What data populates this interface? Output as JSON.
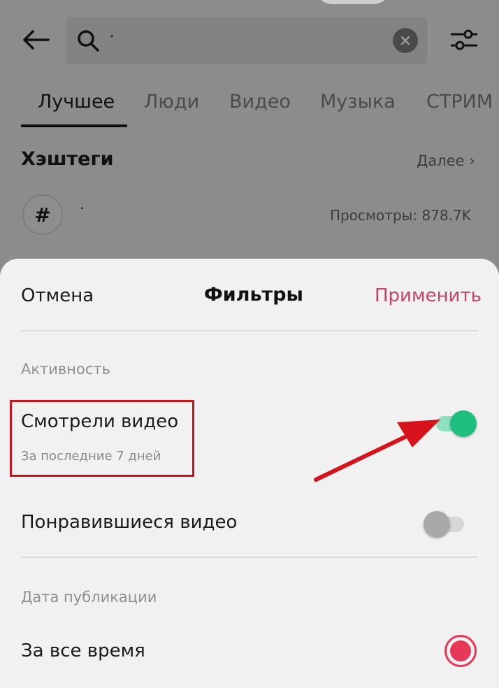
{
  "search": {
    "value": "·"
  },
  "tabs": [
    {
      "label": "Лучшее",
      "active": true
    },
    {
      "label": "Люди",
      "active": false
    },
    {
      "label": "Видео",
      "active": false
    },
    {
      "label": "Музыка",
      "active": false
    },
    {
      "label": "СТРИМ",
      "active": false
    }
  ],
  "hashtags": {
    "title": "Хэштеги",
    "more": "Далее",
    "item": {
      "icon_symbol": "#",
      "name": "·",
      "views": "Просмотры: 878.7K"
    }
  },
  "filters": {
    "cancel": "Отмена",
    "title": "Фильтры",
    "apply": "Применить",
    "activity": {
      "label": "Активность",
      "watched": {
        "title": "Смотрели видео",
        "subtitle": "За последние 7 дней",
        "enabled": true
      },
      "liked": {
        "title": "Понравившиеся видео",
        "enabled": false
      }
    },
    "publication_date": {
      "label": "Дата публикации",
      "options": [
        {
          "label": "За все время",
          "selected": true
        }
      ]
    }
  },
  "colors": {
    "accent": "#c0476b",
    "toggle_on": "#1fbf7f",
    "radio": "#e8385a",
    "highlight": "#c8161d"
  }
}
